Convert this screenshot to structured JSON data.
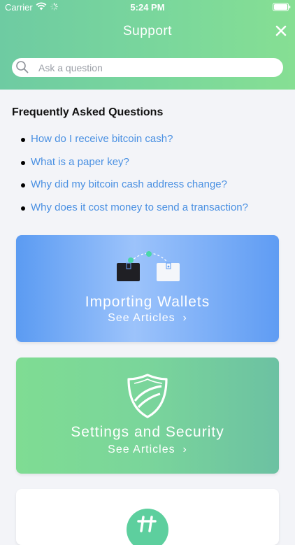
{
  "status_bar": {
    "carrier": "Carrier",
    "time": "5:24 PM"
  },
  "header": {
    "title": "Support"
  },
  "search": {
    "placeholder": "Ask a question"
  },
  "faq": {
    "heading": "Frequently Asked Questions",
    "items": [
      {
        "label": "How do I receive bitcoin cash?"
      },
      {
        "label": "What is a paper key?"
      },
      {
        "label": "Why did my bitcoin cash address change?"
      },
      {
        "label": "Why does it cost money to send a transaction?"
      }
    ]
  },
  "cards": [
    {
      "title": "Importing Wallets",
      "link": "See Articles"
    },
    {
      "title": "Settings and Security",
      "link": "See Articles"
    }
  ],
  "colors": {
    "header_green": "#7ad79c",
    "link_blue": "#4a90e2",
    "card_blue": "#5b9bf2",
    "card_green": "#7ad59b",
    "background": "#f3f4f8"
  }
}
